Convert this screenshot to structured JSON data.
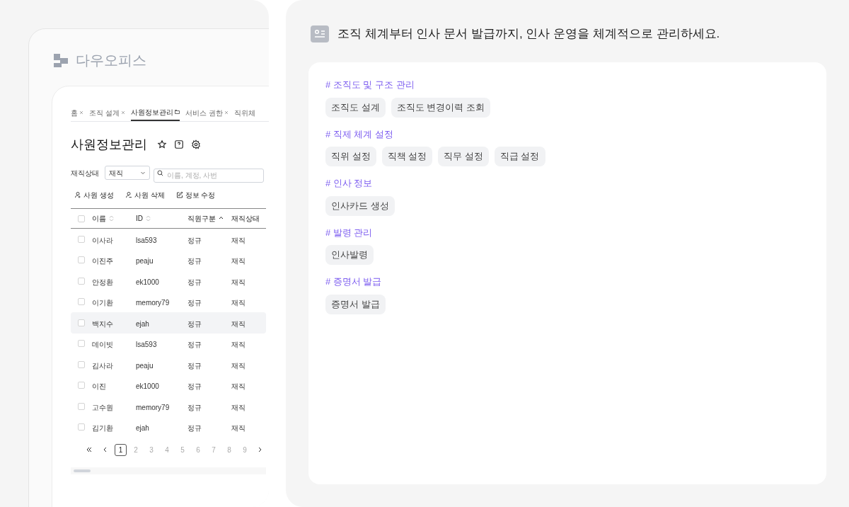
{
  "brand": {
    "name": "다우오피스"
  },
  "tabs": [
    {
      "label": "홈",
      "selected": false,
      "closable": true
    },
    {
      "label": "조직 설계",
      "selected": false,
      "closable": true
    },
    {
      "label": "사원정보관리",
      "selected": true,
      "closable": false
    },
    {
      "label": "서비스 권한",
      "selected": false,
      "closable": true
    },
    {
      "label": "직위체",
      "selected": false,
      "closable": false
    }
  ],
  "page_title": "사원정보관리",
  "filter": {
    "label": "재직상태",
    "value": "재직",
    "search_placeholder": "이름, 계정, 사번"
  },
  "actions": [
    {
      "kind": "add",
      "label": "사원 생성"
    },
    {
      "kind": "remove",
      "label": "사원 삭제"
    },
    {
      "kind": "edit",
      "label": "정보 수정"
    }
  ],
  "table": {
    "all_checked": false,
    "columns": [
      {
        "label": "이름",
        "sortable": true,
        "sorted": false
      },
      {
        "label": "ID",
        "sortable": true,
        "sorted": false
      },
      {
        "label": "직원구분",
        "sortable": true,
        "sorted": true
      },
      {
        "label": "재직상태",
        "sortable": false
      }
    ],
    "rows": [
      {
        "cells": [
          "이사라",
          "lsa593",
          "정규",
          "재직"
        ],
        "selected": false
      },
      {
        "cells": [
          "이진주",
          "peaju",
          "정규",
          "재직"
        ],
        "selected": false
      },
      {
        "cells": [
          "안정환",
          "ek1000",
          "정규",
          "재직"
        ],
        "selected": false
      },
      {
        "cells": [
          "이기환",
          "memory79",
          "정규",
          "재직"
        ],
        "selected": false
      },
      {
        "cells": [
          "백지수",
          "ejah",
          "정규",
          "재직"
        ],
        "selected": true
      },
      {
        "cells": [
          "데이빗",
          "lsa593",
          "정규",
          "재직"
        ],
        "selected": false
      },
      {
        "cells": [
          "김사라",
          "peaju",
          "정규",
          "재직"
        ],
        "selected": false
      },
      {
        "cells": [
          "이진",
          "ek1000",
          "정규",
          "재직"
        ],
        "selected": false
      },
      {
        "cells": [
          "고수원",
          "memory79",
          "정규",
          "재직"
        ],
        "selected": false
      },
      {
        "cells": [
          "김기환",
          "ejah",
          "정규",
          "재직"
        ],
        "selected": false
      }
    ]
  },
  "pagination": [
    {
      "label": "1",
      "selected": true
    },
    {
      "label": "2",
      "selected": false
    },
    {
      "label": "3",
      "selected": false
    },
    {
      "label": "4",
      "selected": false
    },
    {
      "label": "5",
      "selected": false
    },
    {
      "label": "6",
      "selected": false
    },
    {
      "label": "7",
      "selected": false
    },
    {
      "label": "8",
      "selected": false
    },
    {
      "label": "9",
      "selected": false
    }
  ],
  "headline": "조직 체계부터 인사 문서 발급까지, 인사 운영을 체계적으로 관리하세요.",
  "sections": [
    {
      "title": "# 조직도 및 구조 관리",
      "items": [
        "조직도 설계",
        "조직도 변경이력 조회"
      ]
    },
    {
      "title": "# 직제 체계 설정",
      "items": [
        "직위 설정",
        "직책 설정",
        "직무 설정",
        "직급 설정"
      ]
    },
    {
      "title": "# 인사 정보",
      "items": [
        "인사카드 생성"
      ]
    },
    {
      "title": "# 발령 관리",
      "items": [
        "인사발령"
      ]
    },
    {
      "title": "# 증명서 발급",
      "items": [
        "증명서 발급"
      ]
    }
  ]
}
